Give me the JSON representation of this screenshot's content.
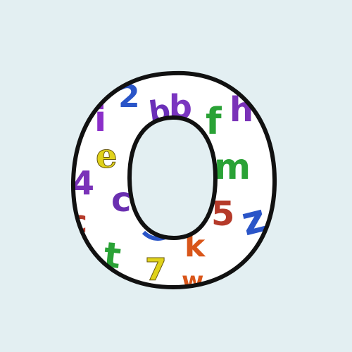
{
  "background_color": "#e3eff2",
  "fill_color": "#ffffff",
  "outline_color": "#111111",
  "letter": {
    "character": "O",
    "glyphs": [
      {
        "char": "2",
        "color": "#2a55c8"
      },
      {
        "char": "i",
        "color": "#8b2fc9"
      },
      {
        "char": "b",
        "color": "#6b2fb8"
      },
      {
        "char": "b",
        "color": "#7a35c0"
      },
      {
        "char": "f",
        "color": "#2aa236"
      },
      {
        "char": "h",
        "color": "#7a32b8"
      },
      {
        "char": "e",
        "color": "#e0d21a"
      },
      {
        "char": "m",
        "color": "#2aa236"
      },
      {
        "char": "4",
        "color": "#7a32b8"
      },
      {
        "char": "c",
        "color": "#6a2fb0"
      },
      {
        "char": "c",
        "color": "#b53a2a"
      },
      {
        "char": "5",
        "color": "#b53a2a"
      },
      {
        "char": "z",
        "color": "#2a55c8"
      },
      {
        "char": "k",
        "color": "#d9561a"
      },
      {
        "char": "t",
        "color": "#2aa236"
      },
      {
        "char": "7",
        "color": "#e0d21a"
      },
      {
        "char": "w",
        "color": "#d9561a"
      }
    ]
  }
}
